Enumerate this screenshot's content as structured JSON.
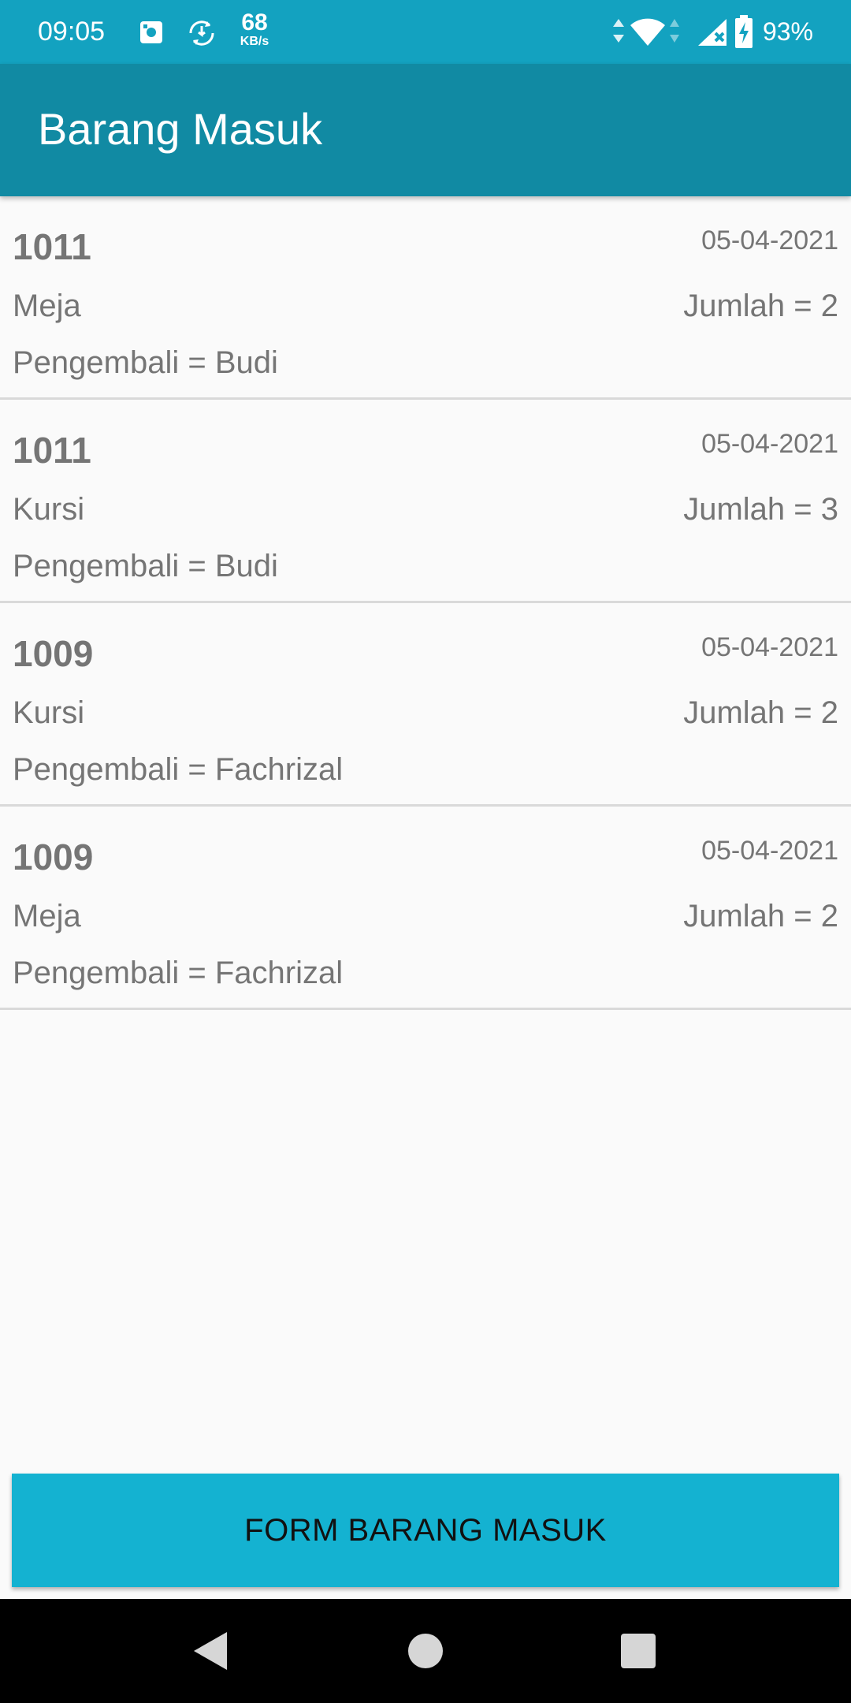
{
  "status_bar": {
    "time": "09:05",
    "net_speed_value": "68",
    "net_speed_unit": "KB/s",
    "battery_percent": "93%",
    "icons": [
      "screenshot-icon",
      "sync-icon",
      "data-arrows-icon",
      "wifi-icon",
      "cell-signal-icon",
      "battery-charging-icon"
    ]
  },
  "app_bar": {
    "title": "Barang Masuk"
  },
  "items": [
    {
      "code": "1011",
      "date": "05-04-2021",
      "name": "Meja",
      "quantity": "Jumlah = 2",
      "returner": "Pengembali = Budi"
    },
    {
      "code": "1011",
      "date": "05-04-2021",
      "name": "Kursi",
      "quantity": "Jumlah = 3",
      "returner": "Pengembali = Budi"
    },
    {
      "code": "1009",
      "date": "05-04-2021",
      "name": "Kursi",
      "quantity": "Jumlah = 2",
      "returner": "Pengembali = Fachrizal"
    },
    {
      "code": "1009",
      "date": "05-04-2021",
      "name": "Meja",
      "quantity": "Jumlah = 2",
      "returner": "Pengembali = Fachrizal"
    }
  ],
  "form_button": {
    "label": "FORM BARANG MASUK"
  },
  "nav_bar": {
    "icons": [
      "back-icon",
      "home-icon",
      "recents-icon"
    ]
  },
  "colors": {
    "status_bar": "#13a2c0",
    "app_bar": "#118aa3",
    "button": "#14b2d1",
    "list_text": "#757575"
  }
}
